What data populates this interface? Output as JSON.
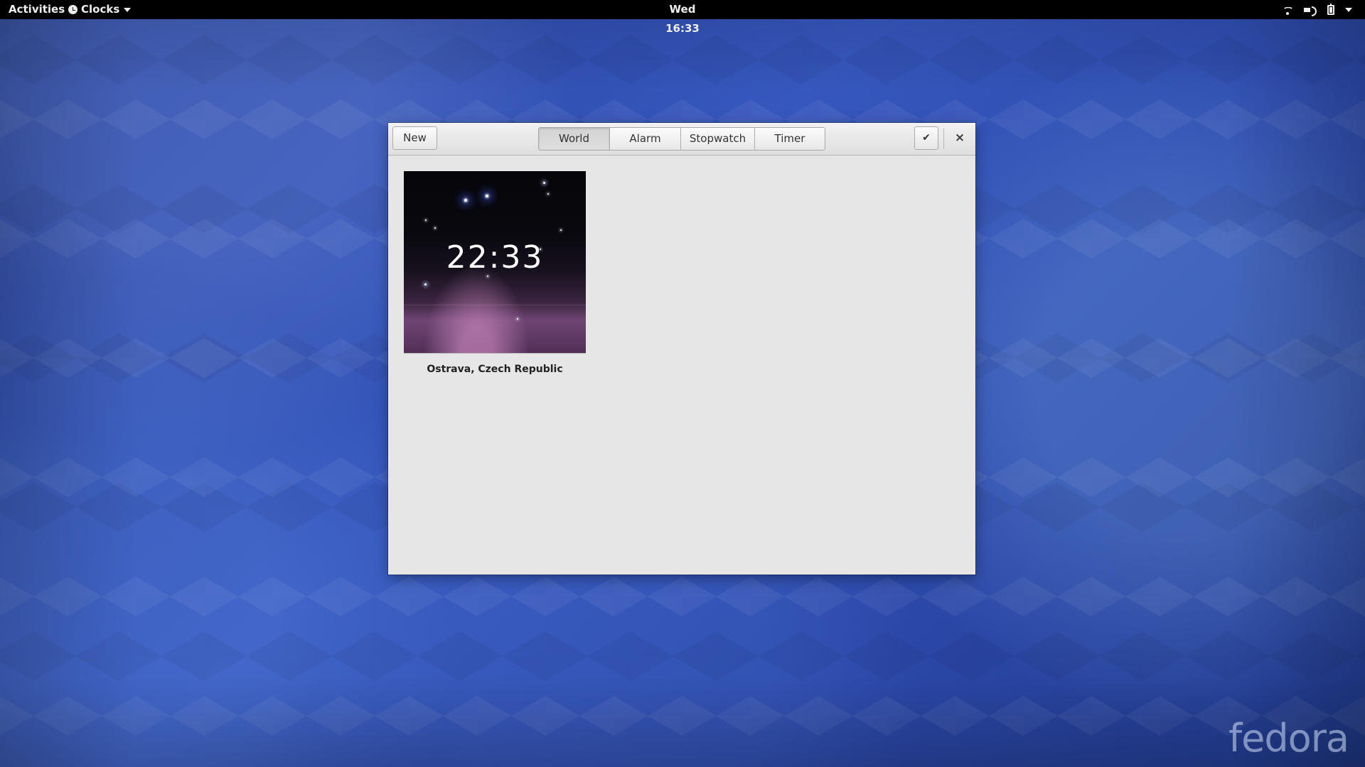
{
  "top_bar": {
    "activities": "Activities",
    "app_menu": "Clocks",
    "clock": "Wed 16:33",
    "icons": [
      "wifi-icon",
      "volume-icon",
      "battery-icon",
      "system-menu-caret-icon"
    ]
  },
  "window": {
    "buttons": {
      "new": "New",
      "select_icon": "✔",
      "close_icon": "×"
    },
    "tabs": [
      {
        "label": "World",
        "active": true
      },
      {
        "label": "Alarm",
        "active": false
      },
      {
        "label": "Stopwatch",
        "active": false
      },
      {
        "label": "Timer",
        "active": false
      }
    ],
    "world_clock": {
      "time": "22:33",
      "city": "Ostrava, Czech Republic"
    }
  },
  "desktop": {
    "watermark": "fedora"
  }
}
